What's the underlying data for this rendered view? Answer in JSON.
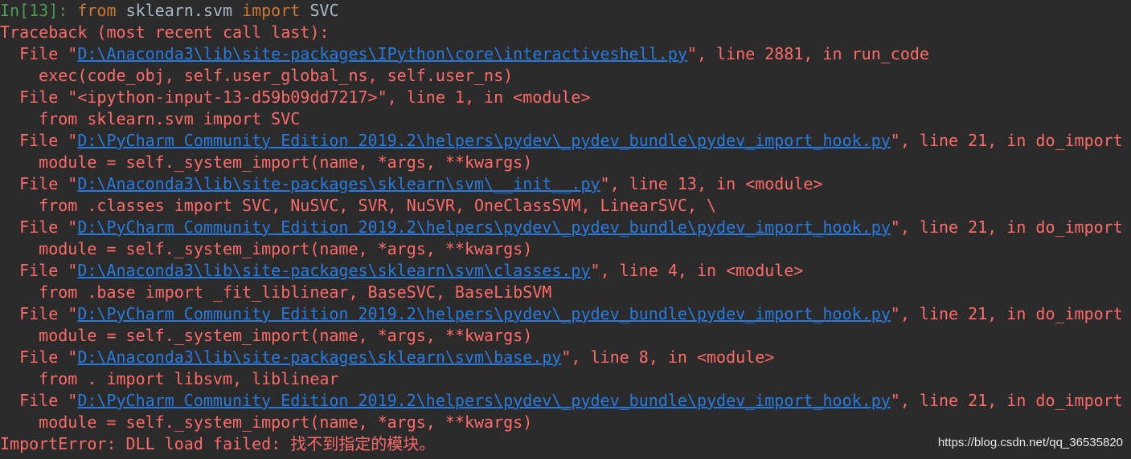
{
  "colors": {
    "background": "#2b2b2b",
    "error_text": "#ff6b68",
    "prompt": "#499c54",
    "keyword": "#cc7832",
    "code": "#a9b7c6",
    "link": "#287bde"
  },
  "input": {
    "prompt": "In[13]:",
    "kw_from": "from",
    "module": "sklearn.svm",
    "kw_import": "import",
    "name": "SVC"
  },
  "traceback": {
    "header": "Traceback (most recent call last):",
    "frames": [
      {
        "prefix": "  File \"",
        "path": "D:\\Anaconda3\\lib\\site-packages\\IPython\\core\\interactiveshell.py",
        "suffix": "\", line 2881, in run_code",
        "code": "    exec(code_obj, self.user_global_ns, self.user_ns)"
      },
      {
        "text": "  File \"<ipython-input-13-d59b09dd7217>\", line 1, in <module>",
        "code": "    from sklearn.svm import SVC"
      },
      {
        "prefix": "  File \"",
        "path": "D:\\PyCharm Community Edition 2019.2\\helpers\\pydev\\_pydev_bundle\\pydev_import_hook.py",
        "suffix": "\", line 21, in do_import",
        "code": "    module = self._system_import(name, *args, **kwargs)"
      },
      {
        "prefix": "  File \"",
        "path": "D:\\Anaconda3\\lib\\site-packages\\sklearn\\svm\\__init__.py",
        "suffix": "\", line 13, in <module>",
        "code": "    from .classes import SVC, NuSVC, SVR, NuSVR, OneClassSVM, LinearSVC, \\"
      },
      {
        "prefix": "  File \"",
        "path": "D:\\PyCharm Community Edition 2019.2\\helpers\\pydev\\_pydev_bundle\\pydev_import_hook.py",
        "suffix": "\", line 21, in do_import",
        "code": "    module = self._system_import(name, *args, **kwargs)"
      },
      {
        "prefix": "  File \"",
        "path": "D:\\Anaconda3\\lib\\site-packages\\sklearn\\svm\\classes.py",
        "suffix": "\", line 4, in <module>",
        "code": "    from .base import _fit_liblinear, BaseSVC, BaseLibSVM"
      },
      {
        "prefix": "  File \"",
        "path": "D:\\PyCharm Community Edition 2019.2\\helpers\\pydev\\_pydev_bundle\\pydev_import_hook.py",
        "suffix": "\", line 21, in do_import",
        "code": "    module = self._system_import(name, *args, **kwargs)"
      },
      {
        "prefix": "  File \"",
        "path": "D:\\Anaconda3\\lib\\site-packages\\sklearn\\svm\\base.py",
        "suffix": "\", line 8, in <module>",
        "code": "    from . import libsvm, liblinear"
      },
      {
        "prefix": "  File \"",
        "path": "D:\\PyCharm Community Edition 2019.2\\helpers\\pydev\\_pydev_bundle\\pydev_import_hook.py",
        "suffix": "\", line 21, in do_import",
        "code": "    module = self._system_import(name, *args, **kwargs)"
      }
    ]
  },
  "error": "ImportError: DLL load failed: 找不到指定的模块。",
  "watermark": "https://blog.csdn.net/qq_36535820"
}
